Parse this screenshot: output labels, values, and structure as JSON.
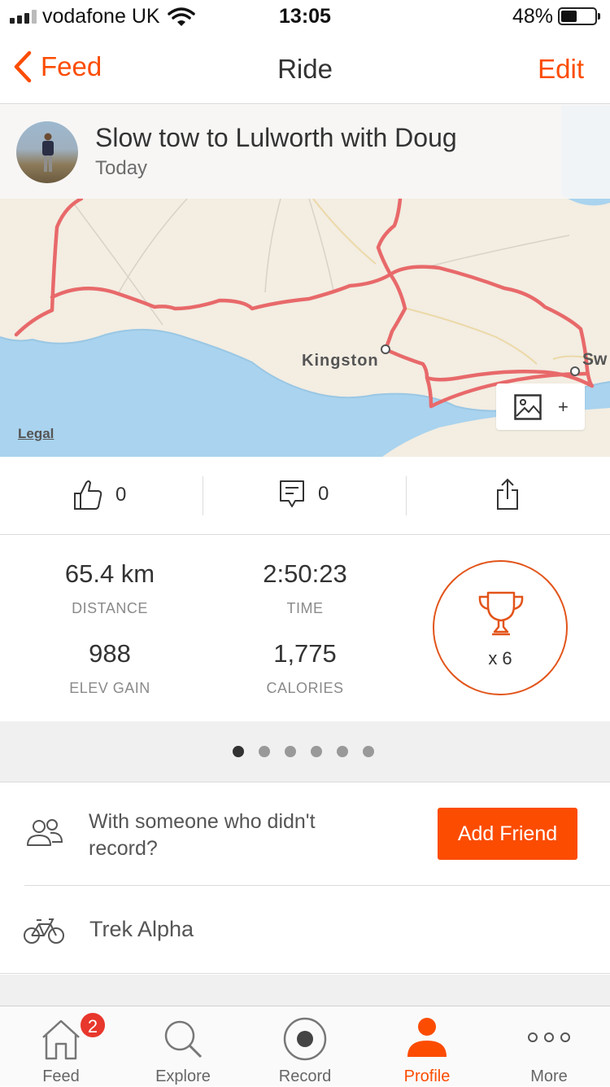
{
  "status_bar": {
    "carrier": "vodafone UK",
    "time": "13:05",
    "battery_percent": "48%",
    "battery_level": 0.48,
    "signal_bars": 3
  },
  "nav": {
    "back_label": "Feed",
    "title": "Ride",
    "edit_label": "Edit"
  },
  "activity": {
    "title": "Slow tow to Lulworth with Doug",
    "date": "Today"
  },
  "map": {
    "labels": {
      "kingston": "Kingston",
      "sw": "Sw"
    },
    "legal": "Legal",
    "add_photo_plus": "+"
  },
  "social": {
    "kudos_count": "0",
    "comments_count": "0"
  },
  "stats": {
    "distance": {
      "value": "65.4 km",
      "label": "DISTANCE"
    },
    "time": {
      "value": "2:50:23",
      "label": "TIME"
    },
    "elev_gain": {
      "value": "988",
      "label": "ELEV GAIN"
    },
    "calories": {
      "value": "1,775",
      "label": "CALORIES"
    },
    "achievements": "x 6"
  },
  "pager": {
    "count": 6,
    "active_index": 0
  },
  "with_friend": {
    "text": "With someone who didn't record?",
    "button_label": "Add Friend"
  },
  "gear": {
    "name": "Trek Alpha"
  },
  "tabbar": {
    "tabs": [
      {
        "label": "Feed",
        "icon": "home-icon",
        "badge": "2"
      },
      {
        "label": "Explore",
        "icon": "search-icon"
      },
      {
        "label": "Record",
        "icon": "record-icon"
      },
      {
        "label": "Profile",
        "icon": "profile-icon",
        "active": true
      },
      {
        "label": "More",
        "icon": "more-icon"
      }
    ]
  },
  "colors": {
    "accent": "#fc4c02",
    "route": "#e8696a",
    "sea": "#a9d3ee",
    "land": "#f3ede2"
  }
}
